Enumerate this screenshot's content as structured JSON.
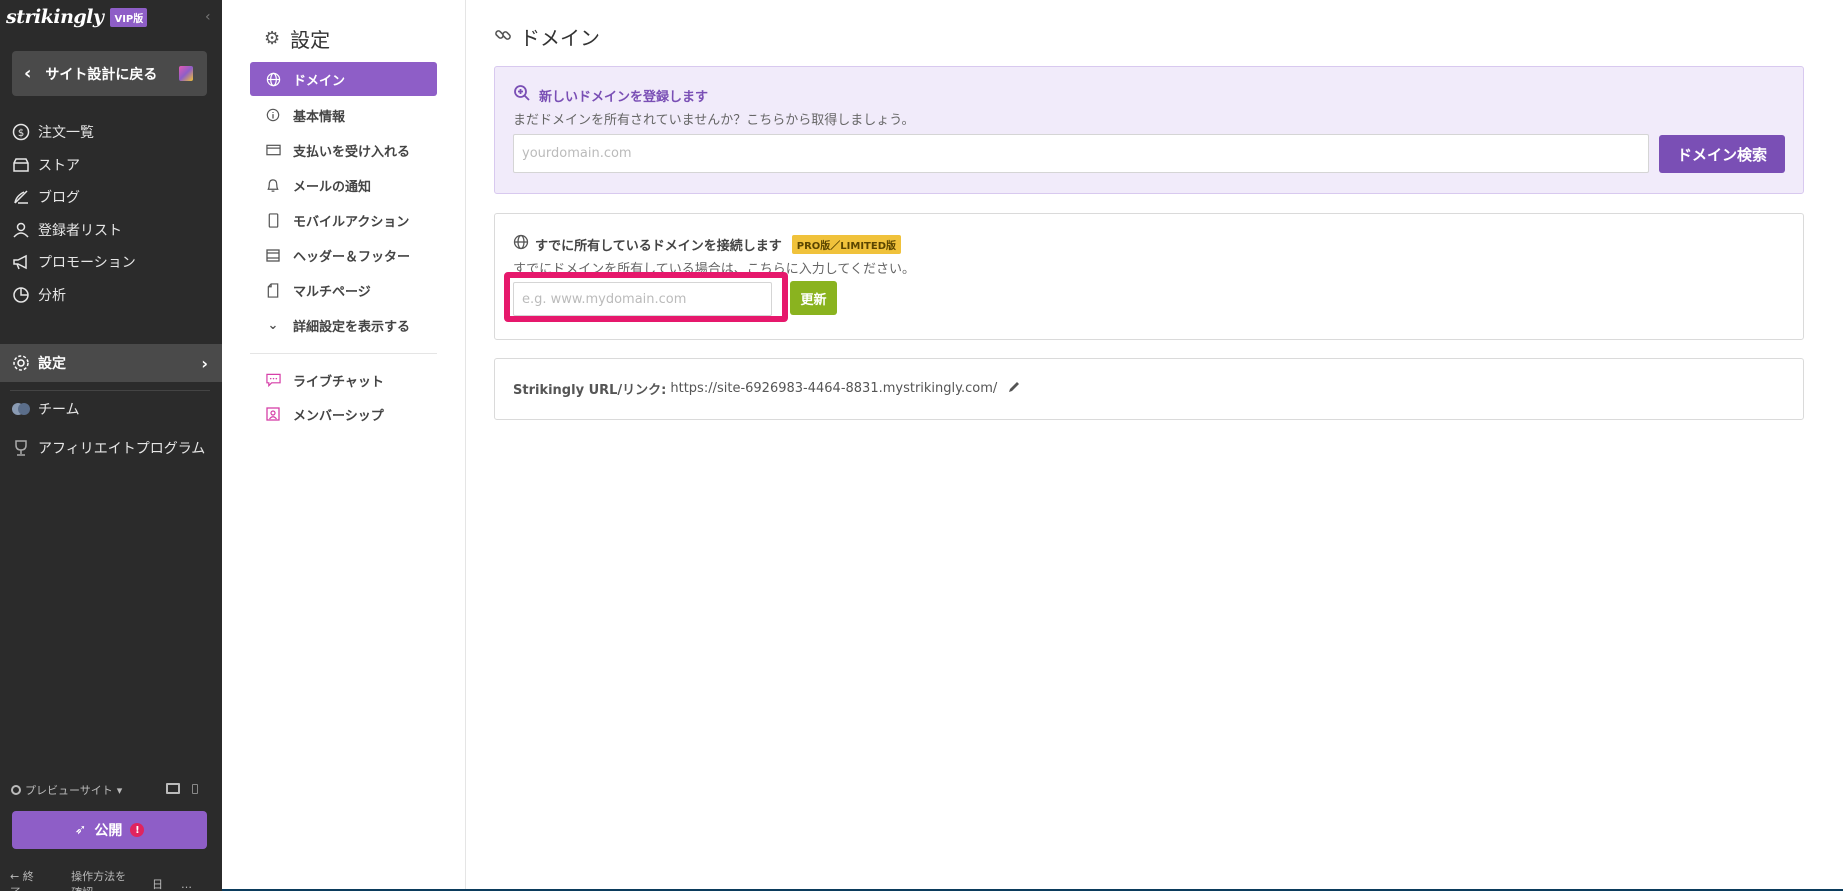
{
  "brand": {
    "logo": "strikingly",
    "vip_label": "VIP版"
  },
  "sidebar": {
    "back_label": "サイト設計に戻る",
    "items": [
      {
        "label": "注文一覧",
        "icon": "dollar-icon"
      },
      {
        "label": "ストア",
        "icon": "store-icon"
      },
      {
        "label": "ブログ",
        "icon": "blog-icon"
      },
      {
        "label": "登録者リスト",
        "icon": "users-icon"
      },
      {
        "label": "プロモーション",
        "icon": "megaphone-icon"
      },
      {
        "label": "分析",
        "icon": "chart-icon"
      },
      {
        "label": "設定",
        "icon": "gear-icon",
        "active": true
      },
      {
        "label": "チーム",
        "icon": "team-icon"
      },
      {
        "label": "アフィリエイトプログラム",
        "icon": "trophy-icon"
      }
    ],
    "preview_label": "プレビューサイト",
    "publish_label": "公開",
    "publish_alert": "!",
    "exit_label": "終了",
    "howto_label": "操作方法を確認",
    "lang_label": "日",
    "more_label": "…"
  },
  "settings_nav": {
    "title": "設定",
    "items": [
      {
        "label": "ドメイン",
        "active": true
      },
      {
        "label": "基本情報"
      },
      {
        "label": "支払いを受け入れる"
      },
      {
        "label": "メールの通知"
      },
      {
        "label": "モバイルアクション"
      },
      {
        "label": "ヘッダー＆フッター"
      },
      {
        "label": "マルチページ"
      },
      {
        "label": "詳細設定を表示する"
      }
    ],
    "extra_items": [
      {
        "label": "ライブチャット"
      },
      {
        "label": "メンバーシップ"
      }
    ]
  },
  "main": {
    "title": "ドメイン",
    "new_domain": {
      "heading": "新しいドメインを登録します",
      "subtext": "まだドメインを所有されていませんか？こちらから取得しましょう。",
      "placeholder": "yourdomain.com",
      "search_button": "ドメイン検索"
    },
    "existing_domain": {
      "heading": "すでに所有しているドメインを接続します",
      "badge": "PRO版／LIMITED版",
      "subtext": "すでにドメインを所有している場合は、こちらに入力してください。",
      "placeholder": "e.g. www.mydomain.com",
      "update_button": "更新"
    },
    "strikingly_url": {
      "label": "Strikingly URL/リンク:",
      "value": "https://site-6926983-4464-8831.mystrikingly.com/"
    }
  },
  "colors": {
    "accent": "#8e5ec7",
    "sidebar_bg": "#2b2b2b",
    "update_green": "#8ab31f",
    "badge_yellow": "#f0c23b",
    "highlight": "#e6186c"
  }
}
